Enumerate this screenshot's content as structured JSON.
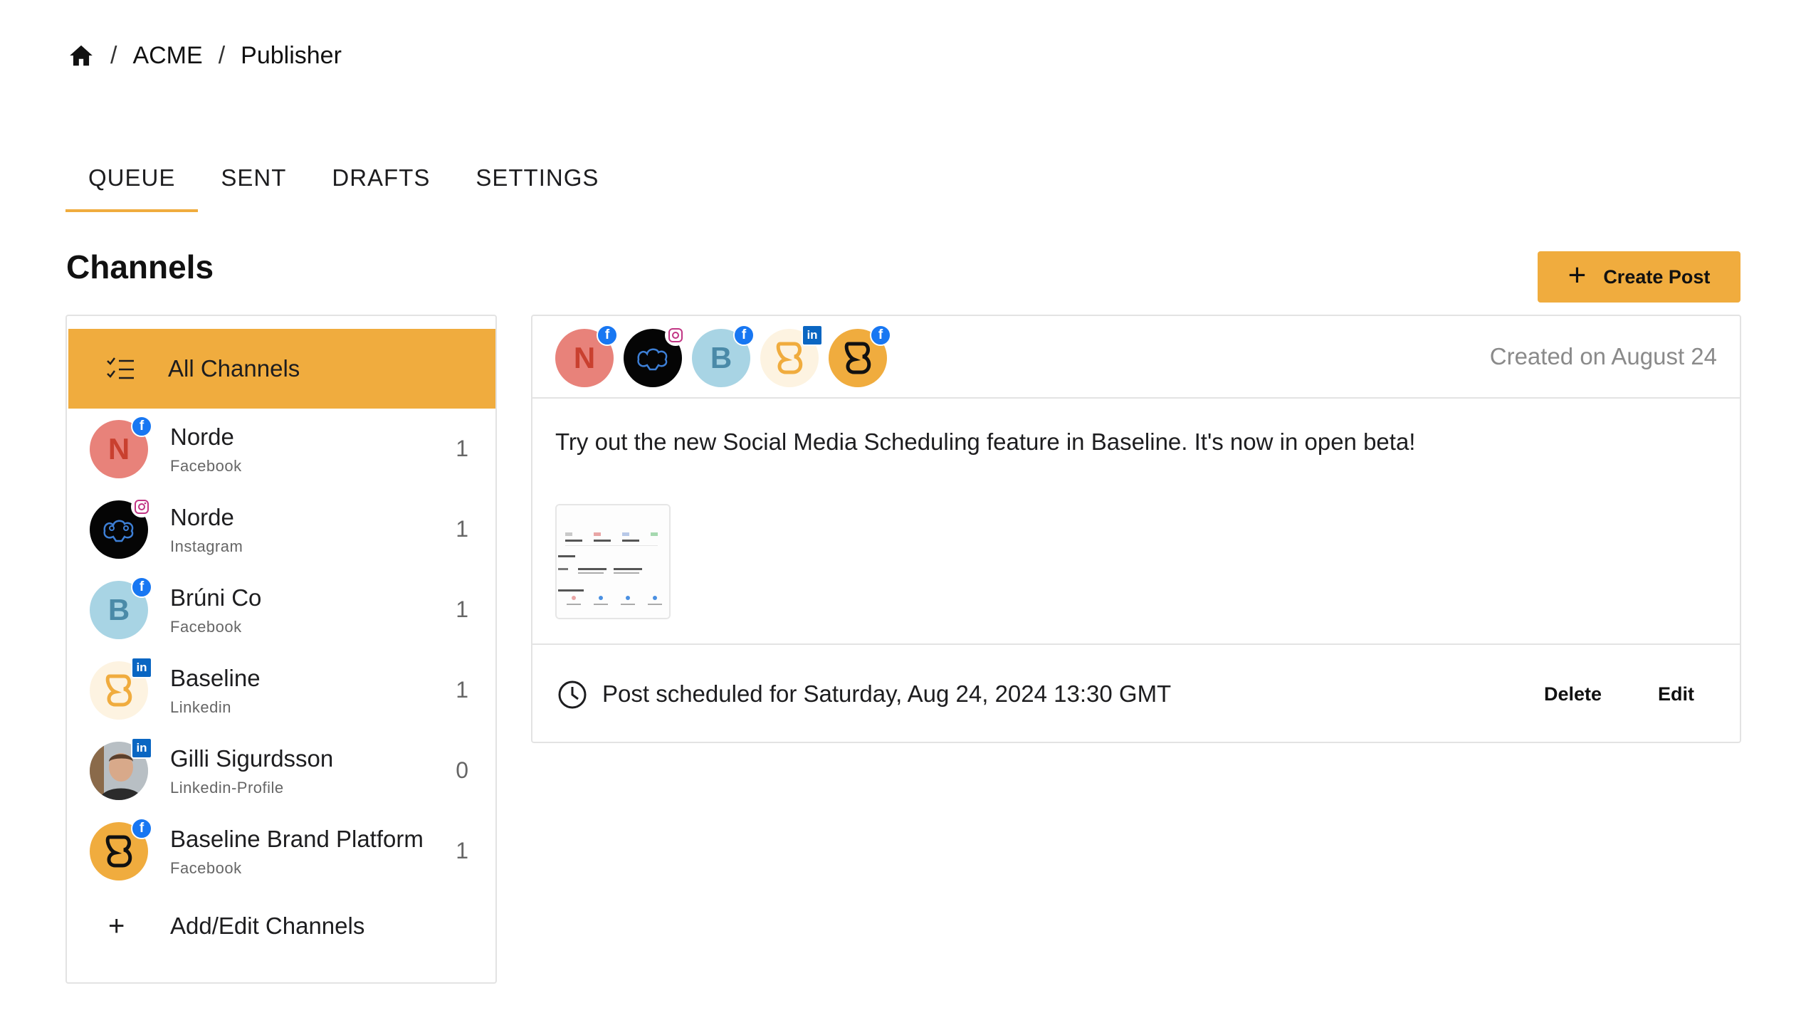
{
  "breadcrumb": {
    "org": "ACME",
    "page": "Publisher",
    "sep": "/"
  },
  "tabs": [
    {
      "label": "QUEUE",
      "active": true
    },
    {
      "label": "SENT",
      "active": false
    },
    {
      "label": "DRAFTS",
      "active": false
    },
    {
      "label": "SETTINGS",
      "active": false
    }
  ],
  "heading": "Channels",
  "create_post": {
    "label": "Create Post",
    "icon": "plus-icon"
  },
  "channels": {
    "all_label": "All Channels",
    "items": [
      {
        "name": "Norde",
        "type": "Facebook",
        "count": "1",
        "avatar_letter": "N",
        "network": "facebook"
      },
      {
        "name": "Norde",
        "type": "Instagram",
        "count": "1",
        "avatar_letter": "",
        "network": "instagram"
      },
      {
        "name": "Brúni Co",
        "type": "Facebook",
        "count": "1",
        "avatar_letter": "B",
        "network": "facebook"
      },
      {
        "name": "Baseline",
        "type": "Linkedin",
        "count": "1",
        "avatar_letter": "",
        "network": "linkedin"
      },
      {
        "name": "Gilli Sigurdsson",
        "type": "Linkedin-Profile",
        "count": "0",
        "avatar_letter": "",
        "network": "linkedin"
      },
      {
        "name": "Baseline Brand Platform",
        "type": "Facebook",
        "count": "1",
        "avatar_letter": "",
        "network": "facebook"
      }
    ],
    "add_edit_label": "Add/Edit Channels"
  },
  "post": {
    "created": "Created on August 24",
    "body": "Try out the new Social Media Scheduling feature in Baseline. It's now in open beta!",
    "scheduled": "Post scheduled for Saturday, Aug 24, 2024 13:30 GMT",
    "delete_label": "Delete",
    "edit_label": "Edit"
  },
  "colors": {
    "accent": "#f0ac3e",
    "norde_red": "#e8827a",
    "bruni_blue": "#a8d4e4",
    "facebook": "#1877f2",
    "linkedin": "#0a66c2"
  }
}
